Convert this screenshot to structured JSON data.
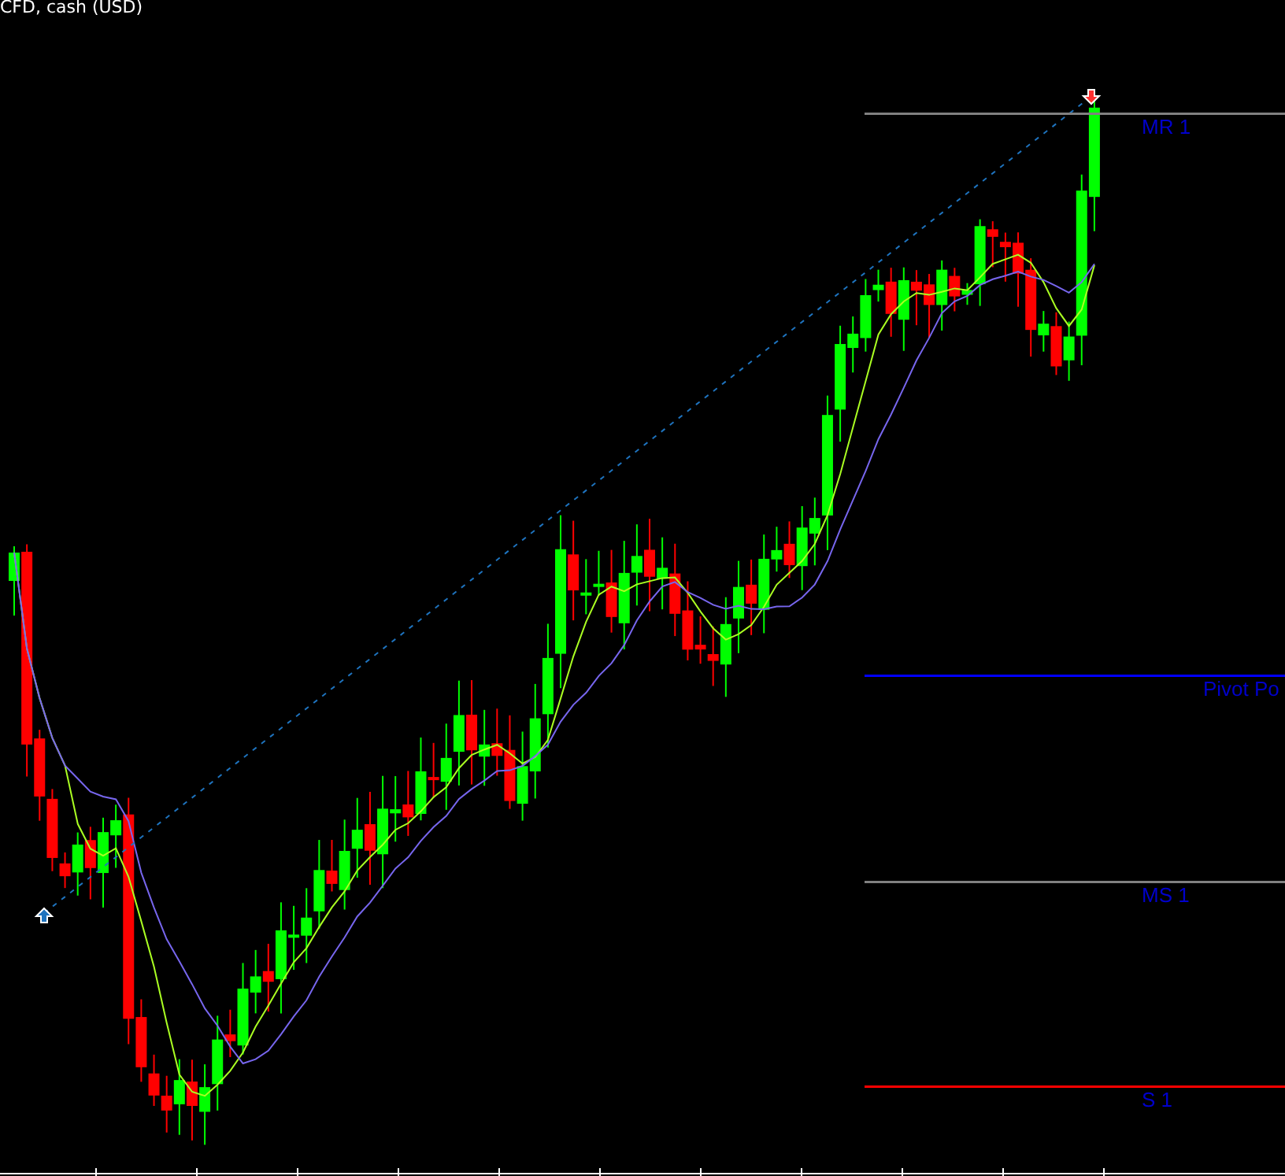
{
  "title": "CFD, cash (USD)",
  "levels": [
    {
      "label": "MR 1",
      "color": "#808080"
    },
    {
      "label": "Pivot Po",
      "color": "#0000ff"
    },
    {
      "label": "MS 1",
      "color": "#808080"
    },
    {
      "label": "S 1",
      "color": "#ff0000"
    }
  ]
}
